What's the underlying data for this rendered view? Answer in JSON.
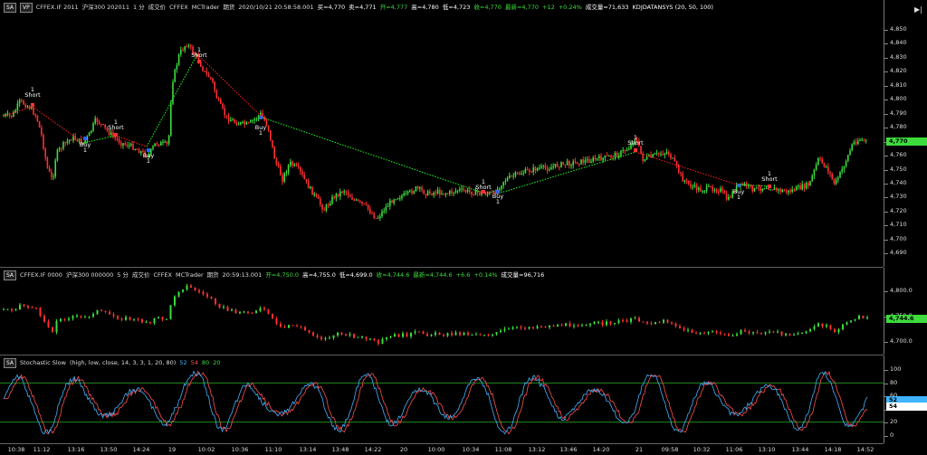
{
  "price_pane": {
    "header": {
      "controls": [
        "SA",
        "VP"
      ],
      "symbol": "CFFEX.IF 2011",
      "name": "沪深300 202011",
      "interval": "1 分",
      "label1": "成交价",
      "exchange": "CFFEX",
      "platform": "MCTrader",
      "category": "期货",
      "datetime": "2020/10/21  20:58:58.001",
      "fields": [
        {
          "text": "买=4,770",
          "color": "#ffffff"
        },
        {
          "text": "卖=4,771",
          "color": "#ffffff"
        },
        {
          "text": "开=4,777",
          "color": "#3cdc3c"
        },
        {
          "text": "高=4,780",
          "color": "#ffffff"
        },
        {
          "text": "低=4,723",
          "color": "#ffffff"
        },
        {
          "text": "收=4,770",
          "color": "#3cdc3c"
        },
        {
          "text": "最新=4,770",
          "color": "#3cdc3c"
        },
        {
          "text": "+12",
          "color": "#3cdc3c"
        },
        {
          "text": "+0.24%",
          "color": "#3cdc3c"
        },
        {
          "text": "成交量=71,633",
          "color": "#ffffff"
        },
        {
          "text": "KDJDATANSYS (20, 50, 100)",
          "color": "#ffffff"
        }
      ]
    },
    "axis_ticks": [
      "4,850",
      "4,840",
      "4,830",
      "4,820",
      "4,810",
      "4,800",
      "4,790",
      "4,780",
      "4,770",
      "4,760",
      "4,750",
      "4,740",
      "4,730",
      "4,720",
      "4,710",
      "4,700",
      "4,690"
    ],
    "last_price": "4,770",
    "signals": [
      {
        "label": "Short",
        "qty": "1"
      },
      {
        "label": "Buy",
        "qty": "1"
      },
      {
        "label": "Short",
        "qty": "1"
      },
      {
        "label": "Buy",
        "qty": "1"
      },
      {
        "label": "Short",
        "qty": "1"
      },
      {
        "label": "Buy",
        "qty": "1"
      },
      {
        "label": "Short",
        "qty": "1"
      },
      {
        "label": "Buy",
        "qty": "1"
      },
      {
        "label": "Short",
        "qty": "1"
      },
      {
        "label": "Short",
        "qty": "1"
      },
      {
        "label": "Buy",
        "qty": "1"
      },
      {
        "label": "Short",
        "qty": "1"
      }
    ]
  },
  "pane2": {
    "header": {
      "controls": [
        "SA"
      ],
      "symbol": "CFFEX.IF 0000",
      "name": "沪深300 000000",
      "interval": "5 分",
      "label1": "成交价",
      "exchange": "CFFEX",
      "platform": "MCTrader",
      "category": "期货",
      "datetime": "20:59:13.001",
      "fields": [
        {
          "text": "开=4,750.0",
          "color": "#3cdc3c"
        },
        {
          "text": "高=4,755.0",
          "color": "#ffffff"
        },
        {
          "text": "低=4,699.0",
          "color": "#ffffff"
        },
        {
          "text": "收=4,744.6",
          "color": "#3cdc3c"
        },
        {
          "text": "最新=4,744.6",
          "color": "#3cdc3c"
        },
        {
          "text": "+6.6",
          "color": "#3cdc3c"
        },
        {
          "text": "+0.14%",
          "color": "#3cdc3c"
        },
        {
          "text": "成交量=96,716",
          "color": "#ffffff"
        }
      ]
    },
    "axis_ticks": [
      "4,800.0",
      "4,750.0",
      "4,700.0"
    ],
    "last_price": "4,744.6"
  },
  "pane3": {
    "header": {
      "controls": [
        "SA"
      ],
      "title": "Stochastic Slow",
      "params": "(high, low, close, 14, 3, 3, 1, 20, 80)",
      "values": [
        {
          "text": "52",
          "color": "#40b4ff"
        },
        {
          "text": "54",
          "color": "#ff5050"
        },
        {
          "text": "80",
          "color": "#3cdc3c"
        },
        {
          "text": "20",
          "color": "#3cdc3c"
        }
      ]
    },
    "axis_ticks": [
      "100",
      "80",
      "60",
      "40",
      "20",
      "0"
    ],
    "tags": [
      "52",
      "54"
    ]
  },
  "time_axis": [
    "10:38",
    "11:12",
    "13:16",
    "13:50",
    "14:24",
    "19",
    "10:02",
    "10:36",
    "11:10",
    "13:14",
    "13:48",
    "14:22",
    "20",
    "10:00",
    "10:34",
    "11:08",
    "13:12",
    "13:46",
    "14:20",
    "21",
    "09:58",
    "10:32",
    "11:06",
    "13:10",
    "13:44",
    "14:18",
    "14:52"
  ],
  "colors": {
    "up": "#3cdc3c",
    "down": "#ff3030",
    "short_line": "#ff2020",
    "long_line": "#20ff20",
    "stoch_k": "#40b4ff",
    "stoch_d": "#ff5050",
    "stoch_levels": "#1f8a1f",
    "last_tag": "#3cdc3c"
  }
}
